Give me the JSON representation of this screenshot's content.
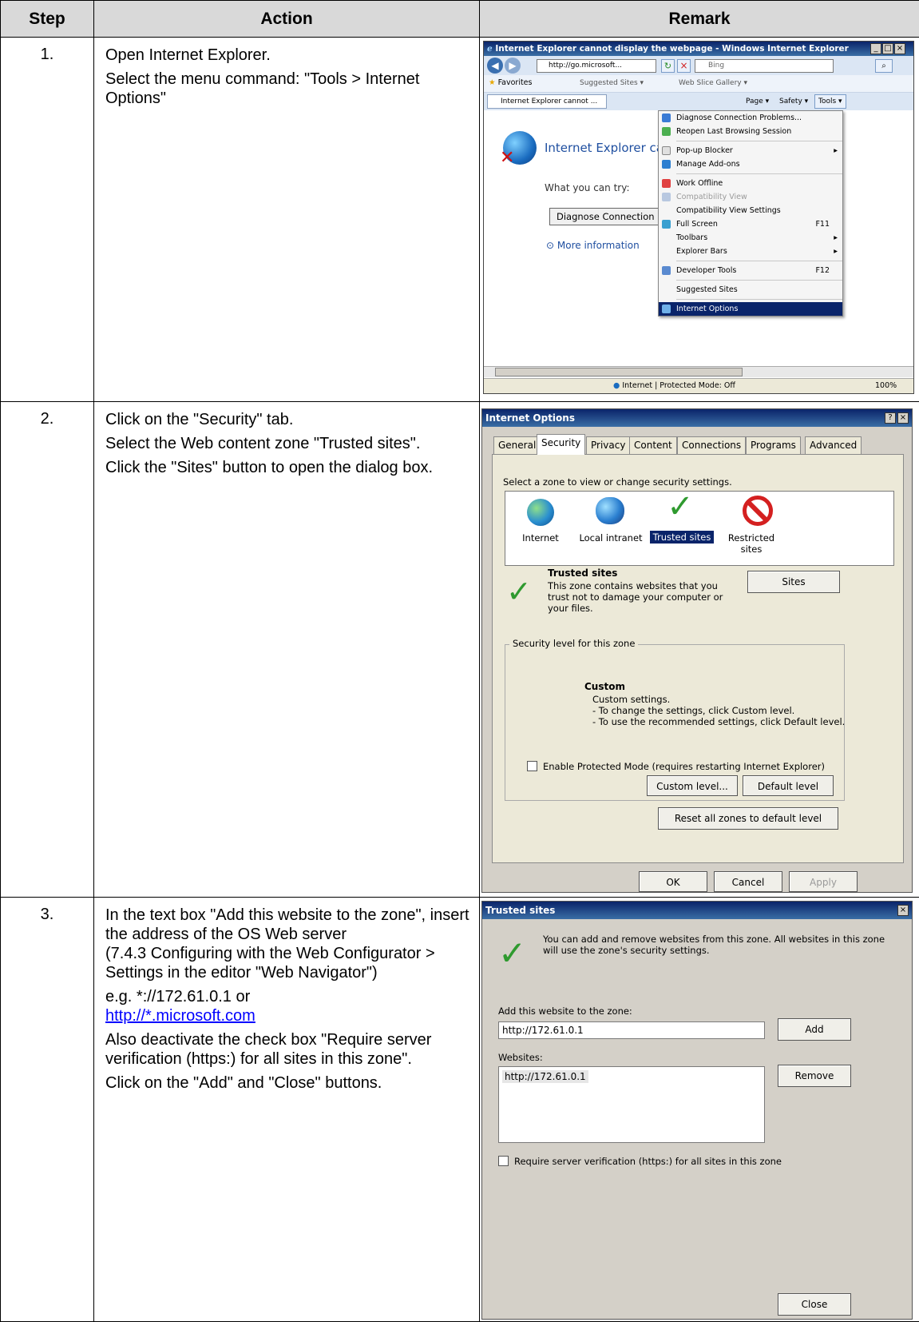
{
  "table": {
    "headers": {
      "step": "Step",
      "action": "Action",
      "remark": "Remark"
    },
    "rows": [
      {
        "step": "1.",
        "action": [
          "Open Internet Explorer.",
          "Select the menu command: \"Tools > Internet Options\""
        ]
      },
      {
        "step": "2.",
        "action": [
          "Click on the \"Security\" tab.",
          "Select the Web content zone \"Trusted sites\".",
          "Click the \"Sites\" button to open the dialog box."
        ]
      },
      {
        "step": "3.",
        "action": [
          "In the text box \"Add this website to the zone\", insert the address of the OS Web server",
          "(7.4.3 Configuring with the Web Configurator > Settings in the editor \"Web Navigator\")",
          "e.g. *://172.61.0.1 or",
          "http://*.microsoft.com",
          "Also deactivate the check box \"Require server verification (https:) for all sites in this zone\".",
          "Click on the \"Add\" and \"Close\" buttons."
        ]
      }
    ]
  },
  "ie": {
    "title": "Internet Explorer cannot display the webpage - Windows Internet Explorer",
    "address": "http://go.microsoft...",
    "search": "Bing",
    "favorites": "Favorites",
    "suggested_sites": "Suggested Sites ▾",
    "web_slice": "Web Slice Gallery ▾",
    "tab": "Internet Explorer cannot ...",
    "cmd_page": "Page ▾",
    "cmd_safety": "Safety ▾",
    "cmd_tools": "Tools ▾",
    "page_heading": "Internet Explorer ca",
    "what_you_can_try": "What you can try:",
    "diagnose_button": "Diagnose Connection P",
    "more_info": "More information",
    "status": "Internet | Protected Mode: Off",
    "zoom": "100%",
    "menu": {
      "diagnose": "Diagnose Connection Problems...",
      "reopen": "Reopen Last Browsing Session",
      "popup": "Pop-up Blocker",
      "addons": "Manage Add-ons",
      "work_offline": "Work Offline",
      "compat_view": "Compatibility View",
      "compat_settings": "Compatibility View Settings",
      "full_screen": "Full Screen",
      "full_screen_key": "F11",
      "toolbars": "Toolbars",
      "explorer_bars": "Explorer Bars",
      "dev_tools": "Developer Tools",
      "dev_tools_key": "F12",
      "suggested": "Suggested Sites",
      "internet_options": "Internet Options"
    }
  },
  "options": {
    "title": "Internet Options",
    "tabs": [
      "General",
      "Security",
      "Privacy",
      "Content",
      "Connections",
      "Programs",
      "Advanced"
    ],
    "select_zone": "Select a zone to view or change security settings.",
    "zones": [
      "Internet",
      "Local intranet",
      "Trusted sites",
      "Restricted sites"
    ],
    "zone_heading": "Trusted sites",
    "zone_desc": "This zone contains websites that you trust not to damage your computer or your files.",
    "sites_button": "Sites",
    "group_label": "Security level for this zone",
    "custom_heading": "Custom",
    "custom_lines": [
      "Custom settings.",
      "- To change the settings, click Custom level.",
      "- To use the recommended settings, click Default level."
    ],
    "protected_mode": "Enable Protected Mode (requires restarting Internet Explorer)",
    "custom_level": "Custom level...",
    "default_level": "Default level",
    "reset_all": "Reset all zones to default level",
    "ok": "OK",
    "cancel": "Cancel",
    "apply": "Apply"
  },
  "trusted": {
    "title": "Trusted sites",
    "intro": "You can add and remove websites from this zone. All websites in this zone will use the zone's security settings.",
    "add_label": "Add this website to the zone:",
    "add_value": "http://172.61.0.1",
    "add_button": "Add",
    "websites_label": "Websites:",
    "websites": [
      "http://172.61.0.1"
    ],
    "remove_button": "Remove",
    "require_https": "Require server verification (https:) for all sites in this zone",
    "close_button": "Close"
  },
  "colors": {
    "header_bg": "#d9d9d9",
    "link": "#0000ff",
    "titlebar": "#0a246a",
    "menu_highlight": "#0a246a"
  }
}
